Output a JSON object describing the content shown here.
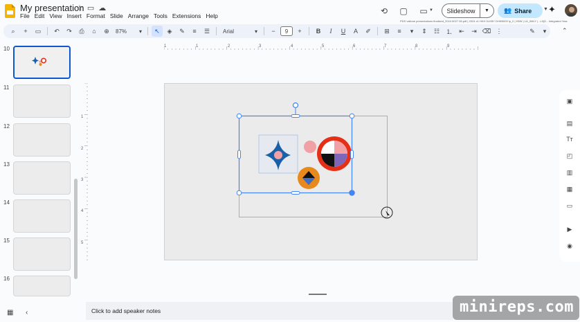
{
  "document": {
    "title": "My presentation"
  },
  "menu": [
    "File",
    "Edit",
    "View",
    "Insert",
    "Format",
    "Slide",
    "Arrange",
    "Tools",
    "Extensions",
    "Help"
  ],
  "header": {
    "slideshow_label": "Slideshow",
    "share_label": "Share"
  },
  "toolbar": {
    "zoom": "87%",
    "font": "Arial",
    "font_size": "9"
  },
  "filmstrip": {
    "slides": [
      "10",
      "11",
      "12",
      "13",
      "14",
      "15",
      "16"
    ],
    "selected": "10"
  },
  "ruler": {
    "h_ticks": [
      "1",
      "1",
      "2",
      "3",
      "4",
      "5",
      "6",
      "7",
      "8",
      "9"
    ],
    "v_ticks": [
      "1",
      "2",
      "3",
      "4",
      "5"
    ]
  },
  "notes": {
    "placeholder": "Click to add speaker notes"
  },
  "header_micro": "PDS vallone presentations finalized_2024 6027 08.pdf | 2024 x1 HKH 0LKBY DHKB009 lp_0 | H5W | LA_0MLY | ..L0(D - Integrated Year",
  "watermark": "minireps.com",
  "colors": {
    "accent": "#0b57d0",
    "share_bg": "#c2e7ff",
    "star_blue": "#1a5fa8",
    "pink": "#f1a0a6",
    "red": "#e52f17",
    "orange": "#e8891e",
    "purple": "#8066b8"
  },
  "icons": [
    "history-icon",
    "comment-icon",
    "meet-icon",
    "gemini-icon",
    "search-icon",
    "undo-icon",
    "redo-icon",
    "print-icon",
    "zoom-icon",
    "select-icon"
  ]
}
